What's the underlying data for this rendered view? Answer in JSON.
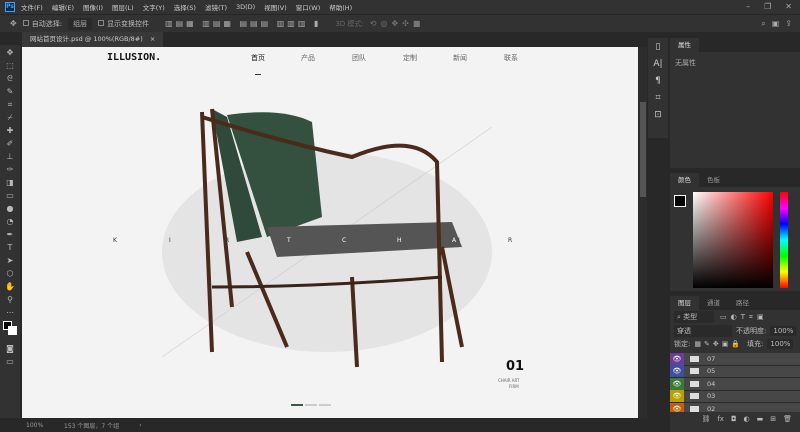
{
  "app": {
    "logo": "Ps",
    "menu": [
      "文件(F)",
      "编辑(E)",
      "图像(I)",
      "图层(L)",
      "文字(Y)",
      "选择(S)",
      "滤镜(T)",
      "3D(D)",
      "视图(V)",
      "窗口(W)",
      "帮助(H)"
    ]
  },
  "options": {
    "auto_select": "自动选择:",
    "auto_select_value": "组层",
    "show_transform": "显示变换控件",
    "mode3d": "3D 模式:"
  },
  "document": {
    "tab": "网站首页设计.psd @ 100%(RGB/8#)",
    "zoom": "100%",
    "info": "153 个图层，7 个组"
  },
  "site": {
    "logo": "ILLUSION.",
    "nav": [
      "首页",
      "产品",
      "团队",
      "定制",
      "新闻",
      "联系"
    ],
    "active_nav": 0,
    "letters": [
      "K",
      "I",
      "R",
      "T",
      "C",
      "H",
      "A",
      "I",
      "R"
    ],
    "slide_number": "01",
    "caption1": "CHAIR ART",
    "caption2": "FIRM"
  },
  "properties": {
    "tab": "属性",
    "empty": "无属性"
  },
  "color": {
    "tabs": [
      "颜色",
      "色板"
    ],
    "hue_color": "#ff0000"
  },
  "layers": {
    "tabs": [
      "图层",
      "通道",
      "路径"
    ],
    "filter": "类型",
    "blend": "穿透",
    "opacity_label": "不透明度:",
    "opacity": "100%",
    "lock_label": "锁定:",
    "fill_label": "填充:",
    "fill": "100%",
    "items": [
      {
        "name": "07",
        "color": "#6a3d9a"
      },
      {
        "name": "05",
        "color": "#3f4fa0"
      },
      {
        "name": "04",
        "color": "#3d7a3a"
      },
      {
        "name": "03",
        "color": "#b8a000"
      },
      {
        "name": "02",
        "color": "#c0600a"
      }
    ]
  }
}
